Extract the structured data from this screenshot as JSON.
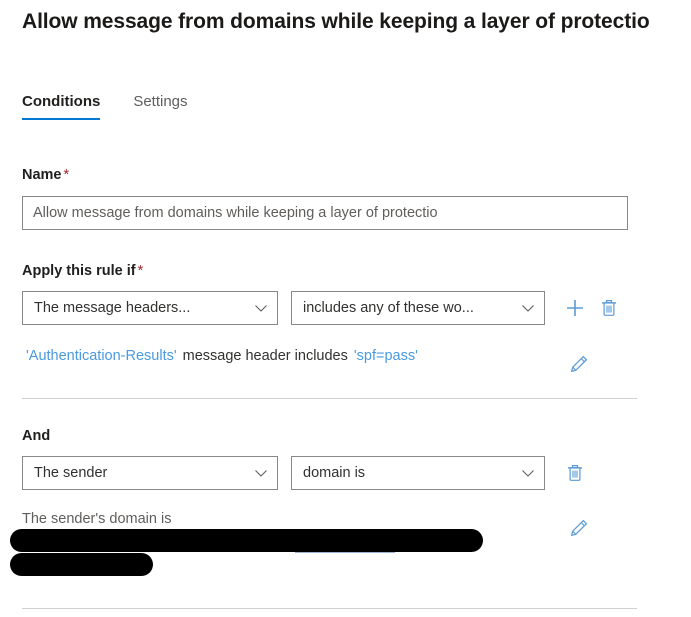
{
  "panel": {
    "title": "Allow message from domains while keeping a layer of protectio"
  },
  "tabs": [
    {
      "label": "Conditions",
      "selected": true
    },
    {
      "label": "Settings",
      "selected": false
    }
  ],
  "fields": {
    "name": {
      "label": "Name",
      "required_marker": "*",
      "value": "Allow message from domains while keeping a layer of protectio",
      "placeholder": "Name"
    },
    "apply_rule_if": {
      "label": "Apply this rule if",
      "required_marker": "*"
    },
    "and": {
      "label": "And"
    }
  },
  "conditions": [
    {
      "condition_dropdown": "The message headers...",
      "operator_dropdown": "includes any of these wo...",
      "summary": {
        "token_left": "'Authentication-Results'",
        "middle": "message header includes",
        "token_right": "'spf=pass'"
      },
      "actions": {
        "add": "add-condition",
        "delete": "delete-condition",
        "edit": "edit-condition"
      }
    },
    {
      "condition_dropdown": "The sender",
      "operator_dropdown": "domain is",
      "summary": {
        "text": "The sender's domain is",
        "value_redacted": true
      },
      "actions": {
        "delete": "delete-condition",
        "edit": "edit-condition"
      }
    }
  ],
  "icons": {
    "chevron_down": "chevron-down-icon",
    "add": "plus-icon",
    "delete": "trash-icon",
    "edit": "pencil-icon"
  },
  "colors": {
    "accent": "#0078d4",
    "icon_blue": "#5b9bd5",
    "required_red": "#a4262c",
    "token_blue": "#4a9ae0",
    "border": "#8a8886",
    "divider": "#d2d0ce",
    "text_primary": "#201f1e",
    "text_secondary": "#605e5c",
    "redaction": "#000000"
  }
}
